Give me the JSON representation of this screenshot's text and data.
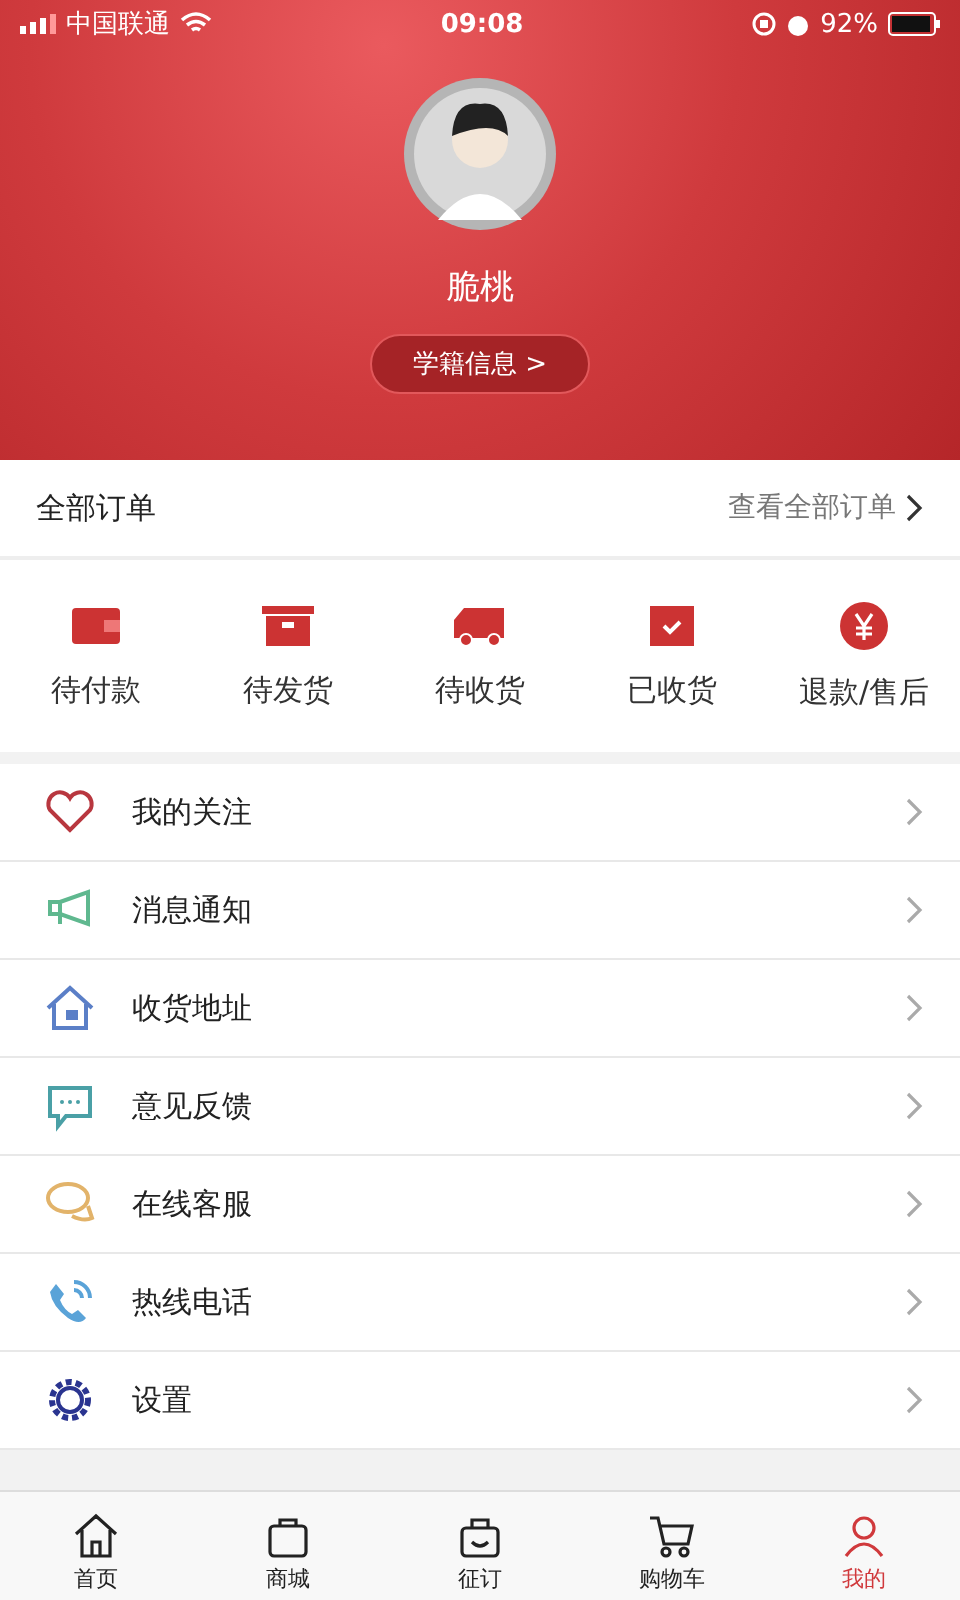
{
  "status_bar": {
    "carrier": "中国联通",
    "time": "09:08",
    "battery": "92%"
  },
  "profile": {
    "name": "脆桃",
    "info_button": "学籍信息 >"
  },
  "orders": {
    "title": "全部订单",
    "link": "查看全部订单",
    "items": [
      {
        "kind": "wallet",
        "label": "待付款"
      },
      {
        "kind": "box",
        "label": "待发货"
      },
      {
        "kind": "truck",
        "label": "待收货"
      },
      {
        "kind": "checkbox",
        "label": "已收货"
      },
      {
        "kind": "yen",
        "label": "退款/售后"
      }
    ]
  },
  "menu": [
    {
      "kind": "heart",
      "label": "我的关注"
    },
    {
      "kind": "megaphone",
      "label": "消息通知"
    },
    {
      "kind": "house",
      "label": "收货地址"
    },
    {
      "kind": "chat",
      "label": "意见反馈"
    },
    {
      "kind": "bubbles",
      "label": "在线客服"
    },
    {
      "kind": "phone",
      "label": "热线电话"
    },
    {
      "kind": "gear",
      "label": "设置"
    }
  ],
  "tab_bar": [
    {
      "kind": "home",
      "label": "首页",
      "selected": false
    },
    {
      "kind": "bag",
      "label": "商城",
      "selected": false
    },
    {
      "kind": "smile",
      "label": "征订",
      "selected": false
    },
    {
      "kind": "cart",
      "label": "购物车",
      "selected": false
    },
    {
      "kind": "person",
      "label": "我的",
      "selected": true
    }
  ]
}
